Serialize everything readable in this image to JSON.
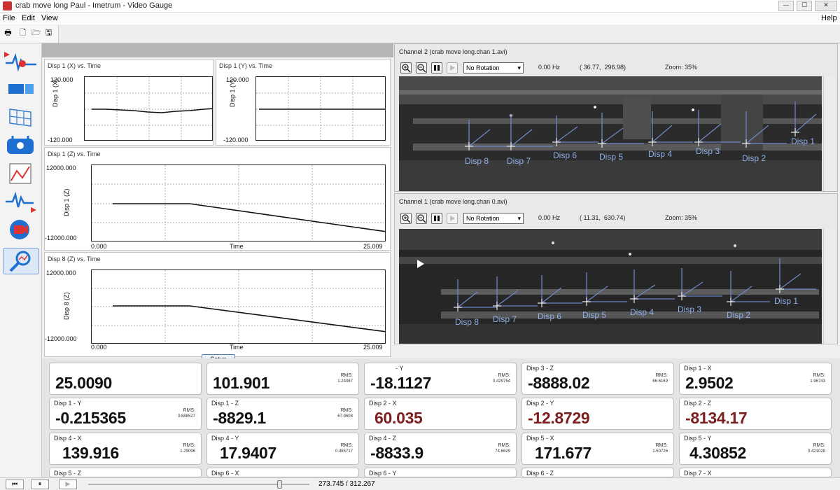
{
  "window": {
    "title": "crab move long Paul - Imetrum - Video Gauge",
    "buttons": [
      "—",
      "☐",
      "✕"
    ]
  },
  "menu": {
    "file": "File",
    "edit": "Edit",
    "view": "View",
    "help": "Help"
  },
  "toolbar": {
    "icons": [
      "print-icon",
      "new-file-icon",
      "open-folder-icon",
      "save-icon"
    ]
  },
  "dock": {
    "items": [
      "waveform-record-icon",
      "camera-rail-icon",
      "calibration-grid-icon",
      "target-tracking-icon",
      "graph-view-icon",
      "signal-analysis-icon",
      "video-camera-icon",
      "search-analyse-icon"
    ],
    "selected_index": 7
  },
  "graphs": {
    "g1": {
      "title": "Disp 1 (X) vs. Time",
      "ylabel": "Disp 1 (X)",
      "ymax": "120.000",
      "ymin": "-120.000"
    },
    "g2": {
      "title": "Disp 1 (Y) vs. Time",
      "ylabel": "Disp 1 (Y)",
      "ymax": "120.000",
      "ymin": "-120.000"
    },
    "g3": {
      "title": "Disp 1 (Z) vs. Time",
      "ylabel": "Disp 1 (Z)",
      "ymax": "12000.000",
      "ymin": "-12000.000",
      "xmin": "0.000",
      "xmax": "25.009",
      "xlabel": "Time"
    },
    "g4": {
      "title": "Disp 8 (Z) vs. Time",
      "ylabel": "Disp 8 (Z)",
      "ymax": "12000.000",
      "ymin": "-12000.000",
      "xmin": "0.000",
      "xmax": "25.009",
      "xlabel": "Time"
    },
    "setup_label": "Setup"
  },
  "channels": {
    "ch2": {
      "title": "Channel 2 (crab move long.chan 1.avi)",
      "rotation": "No Rotation",
      "freq": "0.00 Hz",
      "coords": "( 36.77,  296.98)",
      "zoom": "Zoom: 35%",
      "targets": [
        "Disp 8",
        "Disp 7",
        "Disp 6",
        "Disp 5",
        "Disp 4",
        "Disp 3",
        "Disp 2",
        "Disp 1"
      ]
    },
    "ch1": {
      "title": "Channel 1 (crab move long.chan 0.avi)",
      "rotation": "No Rotation",
      "freq": "0.00 Hz",
      "coords": "( 11.31,  630.74)",
      "zoom": "Zoom: 35%",
      "targets": [
        "Disp 8",
        "Disp 7",
        "Disp 6",
        "Disp 5",
        "Disp 4",
        "Disp 3",
        "Disp 2",
        "Disp 1"
      ]
    }
  },
  "readouts": {
    "row1": [
      {
        "label": "",
        "value": "25.0090",
        "rms_label": "",
        "rms": ""
      },
      {
        "label": "",
        "value": "101.901",
        "rms_label": "RMS:",
        "rms": "1.24087"
      },
      {
        "label": "- Y",
        "value": "-18.1127",
        "rms_label": "RMS:",
        "rms": "0.429754"
      },
      {
        "label": "Disp 3 - Z",
        "value": "-8888.02",
        "rms_label": "RMS:",
        "rms": "66.6169"
      },
      {
        "label": "Disp 1 - X",
        "value": "2.9502",
        "rms_label": "RMS:",
        "rms": "1.96743"
      }
    ],
    "row2": [
      {
        "label": "Disp 1 - Y",
        "value": "-0.215365",
        "rms_label": "RMS:",
        "rms": "0.688527"
      },
      {
        "label": "Disp 1 - Z",
        "value": "-8829.1",
        "rms_label": "RMS:",
        "rms": "67.9608"
      },
      {
        "label": "Disp 2 - X",
        "value": "60.035",
        "rms_label": "",
        "rms": ""
      },
      {
        "label": "Disp 2 - Y",
        "value": "-12.8729",
        "rms_label": "",
        "rms": ""
      },
      {
        "label": "Disp 2 - Z",
        "value": "-8134.17",
        "rms_label": "",
        "rms": ""
      }
    ],
    "row3": [
      {
        "label": "Disp 4 - X",
        "value": "139.916",
        "rms_label": "RMS:",
        "rms": "1.29096"
      },
      {
        "label": "Disp 4 - Y",
        "value": "17.9407",
        "rms_label": "RMS:",
        "rms": "0.465717"
      },
      {
        "label": "Disp 4 - Z",
        "value": "-8833.9",
        "rms_label": "RMS:",
        "rms": "74.6629"
      },
      {
        "label": "Disp 5 - X",
        "value": "171.677",
        "rms_label": "RMS:",
        "rms": "1.50726"
      },
      {
        "label": "Disp 5 - Y",
        "value": "4.30852",
        "rms_label": "RMS:",
        "rms": "0.421028"
      }
    ],
    "row4": [
      {
        "label": "Disp 5 - Z"
      },
      {
        "label": "Disp 6 - X"
      },
      {
        "label": "Disp 6 - Y"
      },
      {
        "label": "Disp 6 - Z"
      },
      {
        "label": "Disp 7 - X"
      }
    ],
    "value_color_red": "#7a1e1e"
  },
  "playback": {
    "time": "273.745 / 312.267",
    "first_btn": "⏮",
    "pause_btn": "⏸",
    "play_btn": "▶"
  }
}
